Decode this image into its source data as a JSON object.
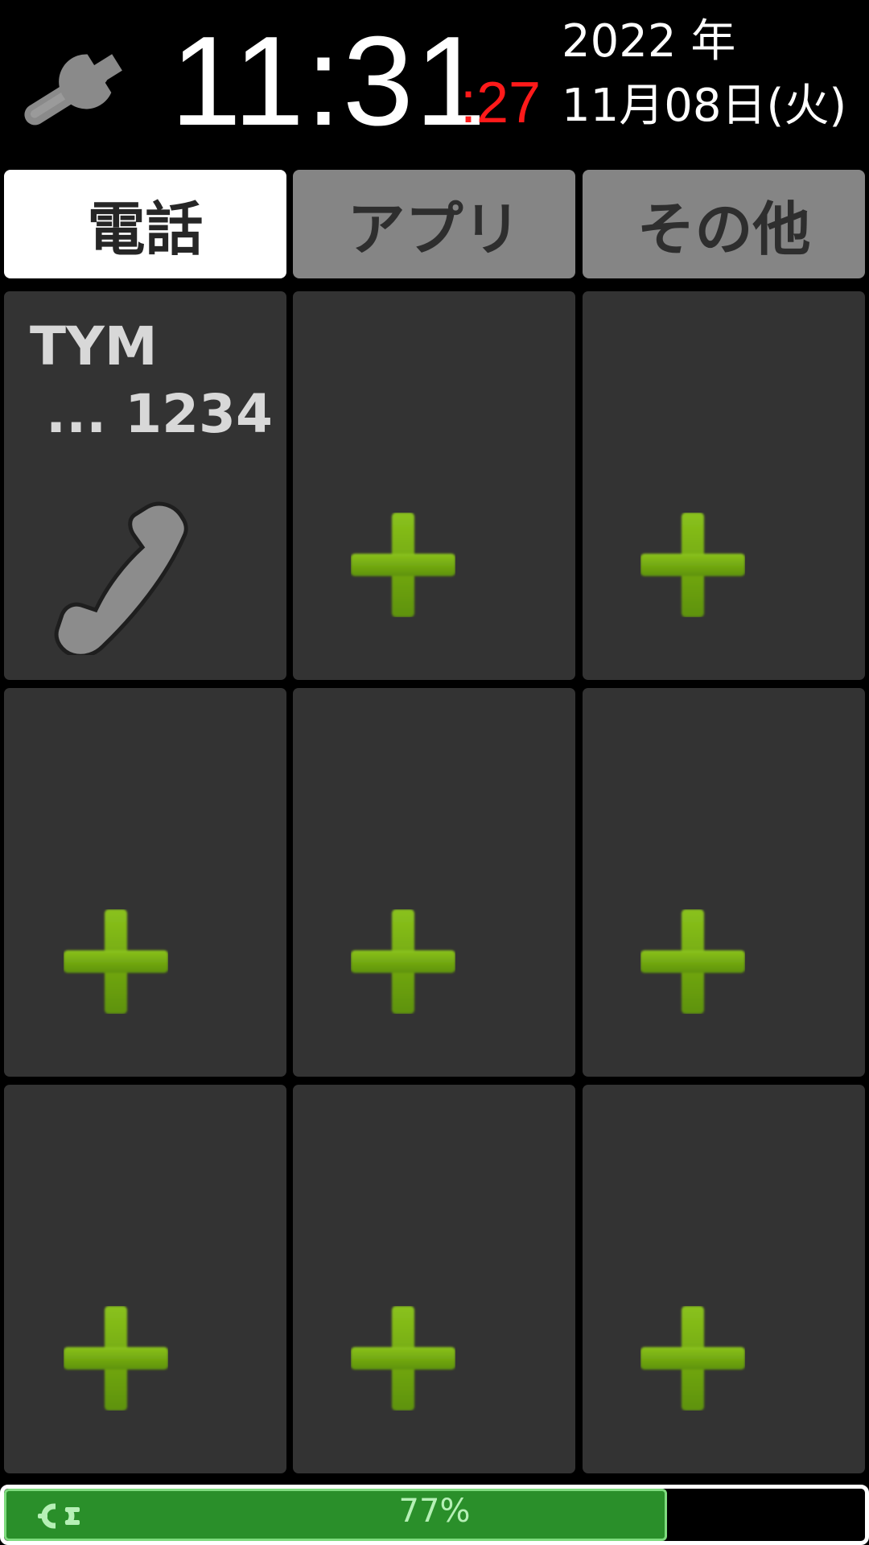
{
  "header": {
    "settings_icon": "wrench-icon",
    "time": "11:31",
    "seconds": ":27",
    "year": "2022 年",
    "date": "11月08日(火)"
  },
  "tabs": [
    {
      "label": "電話",
      "active": true
    },
    {
      "label": "アプリ",
      "active": false
    },
    {
      "label": "その他",
      "active": false
    }
  ],
  "grid": {
    "contact": {
      "name": "TYM",
      "number": "... 1234",
      "icon": "phone-handset-icon"
    },
    "empty_slot_icon": "plus-icon",
    "empty_slot_count": 8
  },
  "battery": {
    "percent_label": "77%",
    "level": 0.77,
    "icon": "charging-plug-icon"
  },
  "colors": {
    "seconds": "#ff1a1a",
    "tab_active": "#ffffff",
    "tab_inactive": "#858585",
    "tile": "#333333",
    "plus": "#78b41e",
    "battery_fill": "#2a8f2a"
  }
}
